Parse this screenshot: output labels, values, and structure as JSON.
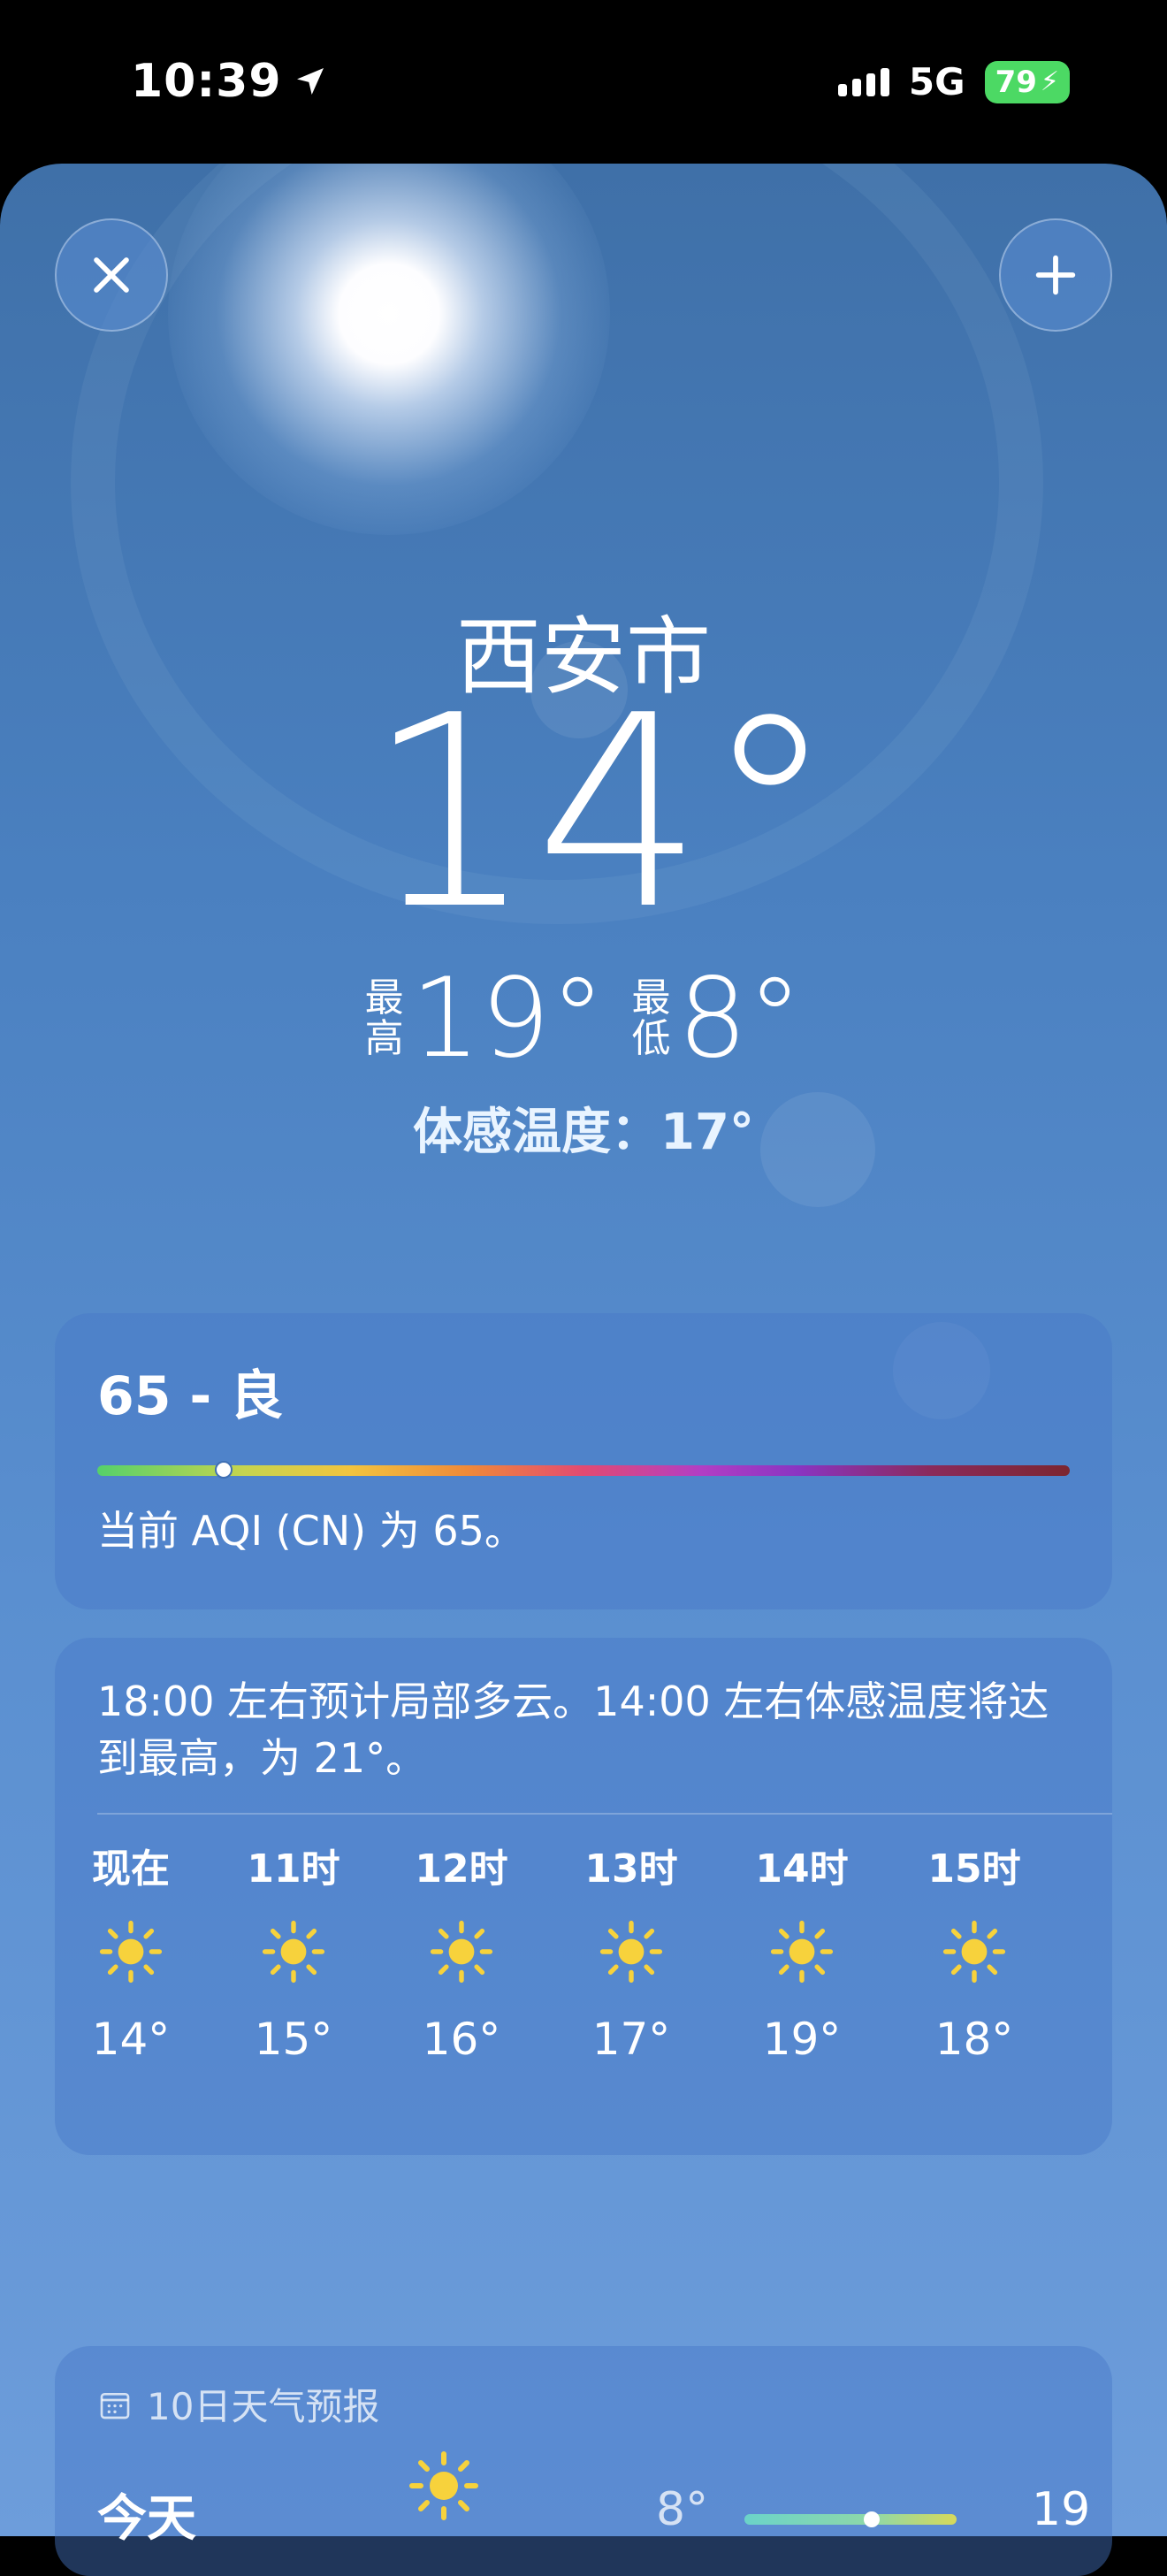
{
  "status_bar": {
    "time": "10:39",
    "network": "5G",
    "battery": "79",
    "battery_color": "#4cd964"
  },
  "header": {
    "close_icon": "close-icon",
    "add_icon": "plus-icon"
  },
  "current": {
    "city": "西安市",
    "temperature": "14°",
    "high_label_line1": "最",
    "high_label_line2": "高",
    "high_value": "19°",
    "low_label_line1": "最",
    "low_label_line2": "低",
    "low_value": "8°",
    "feels_like": "体感温度：17°"
  },
  "aqi": {
    "title": "65 - 良",
    "value": 65,
    "description": "当前 AQI (CN) 为 65。"
  },
  "hourly": {
    "summary": "18:00 左右预计局部多云。14:00 左右体感温度将达到最高，为 21°。",
    "items": [
      {
        "time": "现在",
        "icon": "sun-icon",
        "temp": "14°"
      },
      {
        "time": "11时",
        "icon": "sun-icon",
        "temp": "15°"
      },
      {
        "time": "12时",
        "icon": "sun-icon",
        "temp": "16°"
      },
      {
        "time": "13时",
        "icon": "sun-icon",
        "temp": "17°"
      },
      {
        "time": "14时",
        "icon": "sun-icon",
        "temp": "19°"
      },
      {
        "time": "15时",
        "icon": "sun-icon",
        "temp": "18°"
      }
    ]
  },
  "forecast": {
    "header": "10日天气预报",
    "today_label": "今天",
    "today_low": "8°",
    "today_high": "19"
  }
}
